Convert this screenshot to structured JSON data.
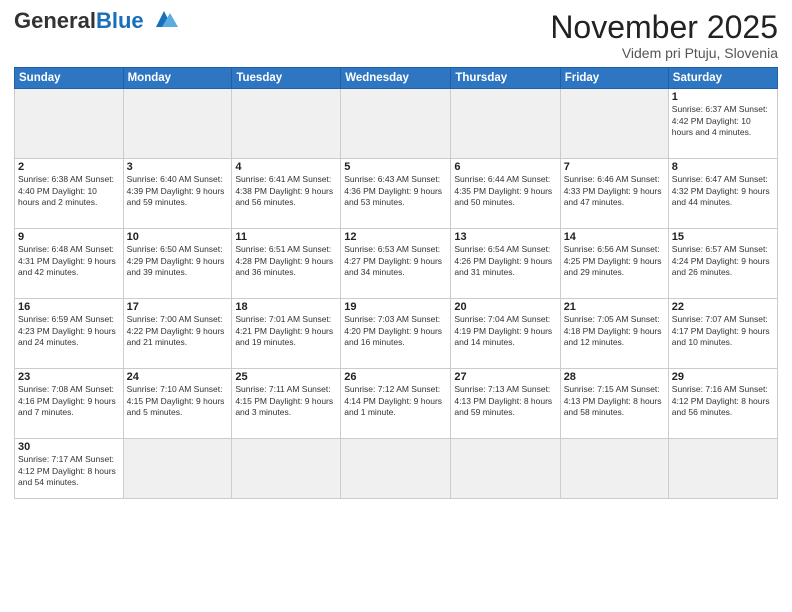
{
  "logo": {
    "general": "General",
    "blue": "Blue"
  },
  "title": "November 2025",
  "subtitle": "Videm pri Ptuju, Slovenia",
  "days_of_week": [
    "Sunday",
    "Monday",
    "Tuesday",
    "Wednesday",
    "Thursday",
    "Friday",
    "Saturday"
  ],
  "weeks": [
    [
      {
        "day": null,
        "info": ""
      },
      {
        "day": null,
        "info": ""
      },
      {
        "day": null,
        "info": ""
      },
      {
        "day": null,
        "info": ""
      },
      {
        "day": null,
        "info": ""
      },
      {
        "day": null,
        "info": ""
      },
      {
        "day": "1",
        "info": "Sunrise: 6:37 AM\nSunset: 4:42 PM\nDaylight: 10 hours and 4 minutes."
      }
    ],
    [
      {
        "day": "2",
        "info": "Sunrise: 6:38 AM\nSunset: 4:40 PM\nDaylight: 10 hours and 2 minutes."
      },
      {
        "day": "3",
        "info": "Sunrise: 6:40 AM\nSunset: 4:39 PM\nDaylight: 9 hours and 59 minutes."
      },
      {
        "day": "4",
        "info": "Sunrise: 6:41 AM\nSunset: 4:38 PM\nDaylight: 9 hours and 56 minutes."
      },
      {
        "day": "5",
        "info": "Sunrise: 6:43 AM\nSunset: 4:36 PM\nDaylight: 9 hours and 53 minutes."
      },
      {
        "day": "6",
        "info": "Sunrise: 6:44 AM\nSunset: 4:35 PM\nDaylight: 9 hours and 50 minutes."
      },
      {
        "day": "7",
        "info": "Sunrise: 6:46 AM\nSunset: 4:33 PM\nDaylight: 9 hours and 47 minutes."
      },
      {
        "day": "8",
        "info": "Sunrise: 6:47 AM\nSunset: 4:32 PM\nDaylight: 9 hours and 44 minutes."
      }
    ],
    [
      {
        "day": "9",
        "info": "Sunrise: 6:48 AM\nSunset: 4:31 PM\nDaylight: 9 hours and 42 minutes."
      },
      {
        "day": "10",
        "info": "Sunrise: 6:50 AM\nSunset: 4:29 PM\nDaylight: 9 hours and 39 minutes."
      },
      {
        "day": "11",
        "info": "Sunrise: 6:51 AM\nSunset: 4:28 PM\nDaylight: 9 hours and 36 minutes."
      },
      {
        "day": "12",
        "info": "Sunrise: 6:53 AM\nSunset: 4:27 PM\nDaylight: 9 hours and 34 minutes."
      },
      {
        "day": "13",
        "info": "Sunrise: 6:54 AM\nSunset: 4:26 PM\nDaylight: 9 hours and 31 minutes."
      },
      {
        "day": "14",
        "info": "Sunrise: 6:56 AM\nSunset: 4:25 PM\nDaylight: 9 hours and 29 minutes."
      },
      {
        "day": "15",
        "info": "Sunrise: 6:57 AM\nSunset: 4:24 PM\nDaylight: 9 hours and 26 minutes."
      }
    ],
    [
      {
        "day": "16",
        "info": "Sunrise: 6:59 AM\nSunset: 4:23 PM\nDaylight: 9 hours and 24 minutes."
      },
      {
        "day": "17",
        "info": "Sunrise: 7:00 AM\nSunset: 4:22 PM\nDaylight: 9 hours and 21 minutes."
      },
      {
        "day": "18",
        "info": "Sunrise: 7:01 AM\nSunset: 4:21 PM\nDaylight: 9 hours and 19 minutes."
      },
      {
        "day": "19",
        "info": "Sunrise: 7:03 AM\nSunset: 4:20 PM\nDaylight: 9 hours and 16 minutes."
      },
      {
        "day": "20",
        "info": "Sunrise: 7:04 AM\nSunset: 4:19 PM\nDaylight: 9 hours and 14 minutes."
      },
      {
        "day": "21",
        "info": "Sunrise: 7:05 AM\nSunset: 4:18 PM\nDaylight: 9 hours and 12 minutes."
      },
      {
        "day": "22",
        "info": "Sunrise: 7:07 AM\nSunset: 4:17 PM\nDaylight: 9 hours and 10 minutes."
      }
    ],
    [
      {
        "day": "23",
        "info": "Sunrise: 7:08 AM\nSunset: 4:16 PM\nDaylight: 9 hours and 7 minutes."
      },
      {
        "day": "24",
        "info": "Sunrise: 7:10 AM\nSunset: 4:15 PM\nDaylight: 9 hours and 5 minutes."
      },
      {
        "day": "25",
        "info": "Sunrise: 7:11 AM\nSunset: 4:15 PM\nDaylight: 9 hours and 3 minutes."
      },
      {
        "day": "26",
        "info": "Sunrise: 7:12 AM\nSunset: 4:14 PM\nDaylight: 9 hours and 1 minute."
      },
      {
        "day": "27",
        "info": "Sunrise: 7:13 AM\nSunset: 4:13 PM\nDaylight: 8 hours and 59 minutes."
      },
      {
        "day": "28",
        "info": "Sunrise: 7:15 AM\nSunset: 4:13 PM\nDaylight: 8 hours and 58 minutes."
      },
      {
        "day": "29",
        "info": "Sunrise: 7:16 AM\nSunset: 4:12 PM\nDaylight: 8 hours and 56 minutes."
      }
    ],
    [
      {
        "day": "30",
        "info": "Sunrise: 7:17 AM\nSunset: 4:12 PM\nDaylight: 8 hours and 54 minutes."
      },
      {
        "day": null,
        "info": ""
      },
      {
        "day": null,
        "info": ""
      },
      {
        "day": null,
        "info": ""
      },
      {
        "day": null,
        "info": ""
      },
      {
        "day": null,
        "info": ""
      },
      {
        "day": null,
        "info": ""
      }
    ]
  ]
}
